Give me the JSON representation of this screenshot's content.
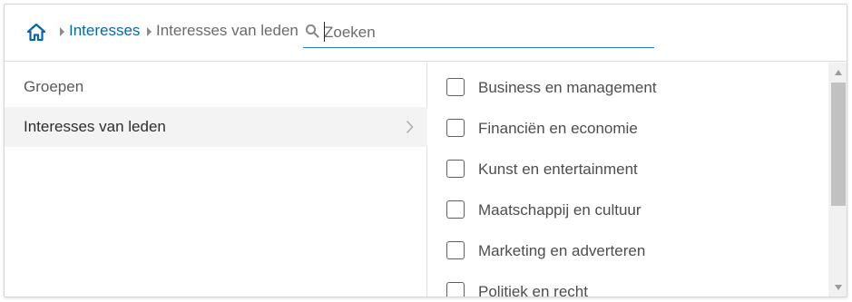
{
  "breadcrumb": {
    "home_icon": "home-icon",
    "items": [
      {
        "label": "Interesses",
        "link": true
      },
      {
        "label": "Interesses van leden",
        "link": false
      }
    ]
  },
  "search": {
    "placeholder": "Zoeken",
    "value": "",
    "icon": "search-icon"
  },
  "left_menu": {
    "items": [
      {
        "label": "Groepen",
        "active": false
      },
      {
        "label": "Interesses van leden",
        "active": true
      }
    ]
  },
  "options": [
    {
      "label": "Business en management",
      "checked": false
    },
    {
      "label": "Financiën en economie",
      "checked": false
    },
    {
      "label": "Kunst en entertainment",
      "checked": false
    },
    {
      "label": "Maatschappij en cultuur",
      "checked": false
    },
    {
      "label": "Marketing en adverteren",
      "checked": false
    },
    {
      "label": "Politiek en recht",
      "checked": false
    }
  ],
  "colors": {
    "accent": "#0a66a8",
    "border": "#d6d6d6",
    "active_row": "#f3f3f3"
  }
}
